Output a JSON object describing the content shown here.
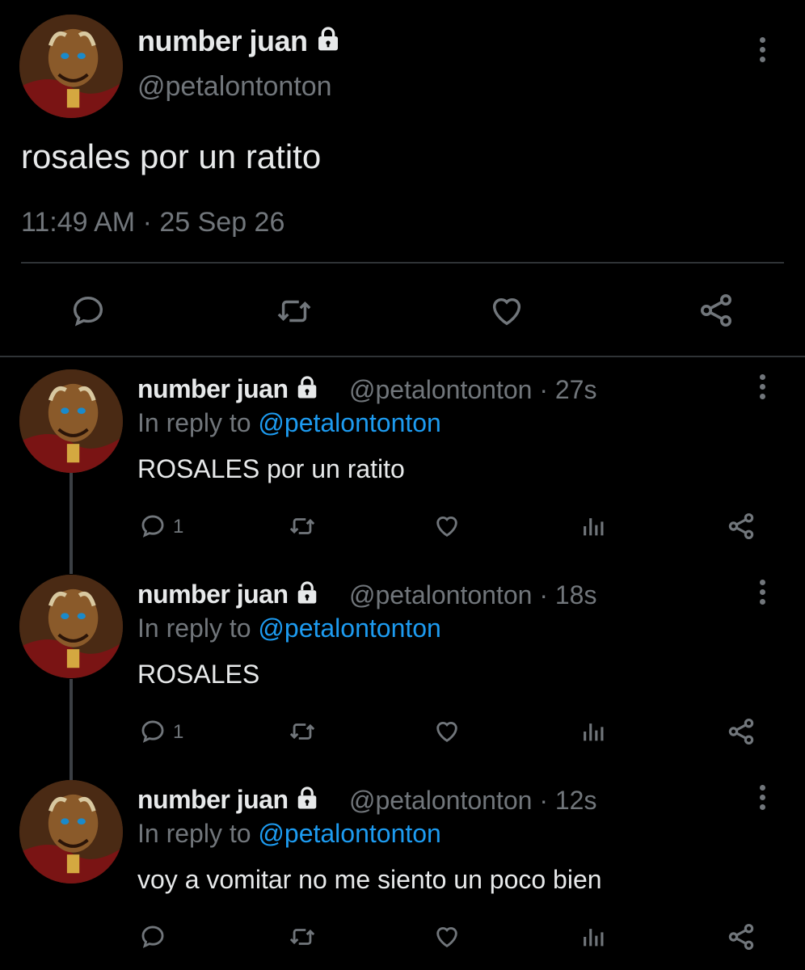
{
  "main_tweet": {
    "name": "number juan",
    "handle": "@petalontonton",
    "text": "rosales por un ratito",
    "timestamp": "11:49 AM · 25 Sep 26",
    "icons": [
      "reply-icon",
      "retweet-icon",
      "like-icon",
      "share-icon"
    ]
  },
  "replies": [
    {
      "name": "number juan",
      "handle_time": "@petalontonton · 27s",
      "in_reply_prefix": "In reply to ",
      "in_reply_mention": "@petalontonton",
      "text": "ROSALES por un ratito",
      "reply_count": "1"
    },
    {
      "name": "number juan",
      "handle_time": "@petalontonton · 18s",
      "in_reply_prefix": "In reply to ",
      "in_reply_mention": "@petalontonton",
      "text": "ROSALES",
      "reply_count": "1"
    },
    {
      "name": "number juan",
      "handle_time": "@petalontonton · 12s",
      "in_reply_prefix": "In reply to ",
      "in_reply_mention": "@petalontonton",
      "text": "voy a vomitar no me siento un poco bien",
      "reply_count": ""
    }
  ],
  "colors": {
    "background": "#000000",
    "text": "#e7e9ea",
    "secondary": "#71767b",
    "mention": "#1d9bf0",
    "divider": "#2f3336"
  }
}
